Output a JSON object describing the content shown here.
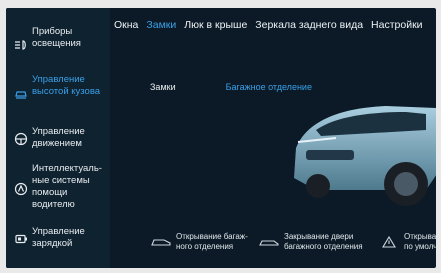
{
  "sidebar": {
    "items": [
      {
        "label": "Приборы освещения",
        "icon": "headlight-icon",
        "active": false
      },
      {
        "label": "Управление высотой кузова",
        "icon": "car-height-icon",
        "active": true
      },
      {
        "label": "Управление движением",
        "icon": "steering-wheel-icon",
        "active": false
      },
      {
        "label": "Интеллектуаль-ные системы помощи водителю",
        "icon": "driver-assist-icon",
        "active": false
      },
      {
        "label": "Управление зарядкой",
        "icon": "battery-icon",
        "active": false
      }
    ]
  },
  "tabs": [
    {
      "label": "Окна",
      "active": false
    },
    {
      "label": "Замки",
      "active": true
    },
    {
      "label": "Люк в крыше",
      "active": false
    },
    {
      "label": "Зеркала заднего вида",
      "active": false
    },
    {
      "label": "Настройки",
      "active": false
    }
  ],
  "subtabs": [
    {
      "label": "Замки",
      "active": false
    },
    {
      "label": "Багажное отделение",
      "active": true
    }
  ],
  "bottom_buttons": [
    {
      "label": "Открывание багаж-ного отделения",
      "icon": "trunk-open-icon"
    },
    {
      "label": "Закрывание двери багажного отделения",
      "icon": "trunk-close-icon"
    },
    {
      "label": "Открывание по умолчанию",
      "icon": "warning-icon"
    }
  ],
  "colors": {
    "accent": "#3aa0e8",
    "background": "#0b1a26",
    "text": "#eef2f5"
  }
}
